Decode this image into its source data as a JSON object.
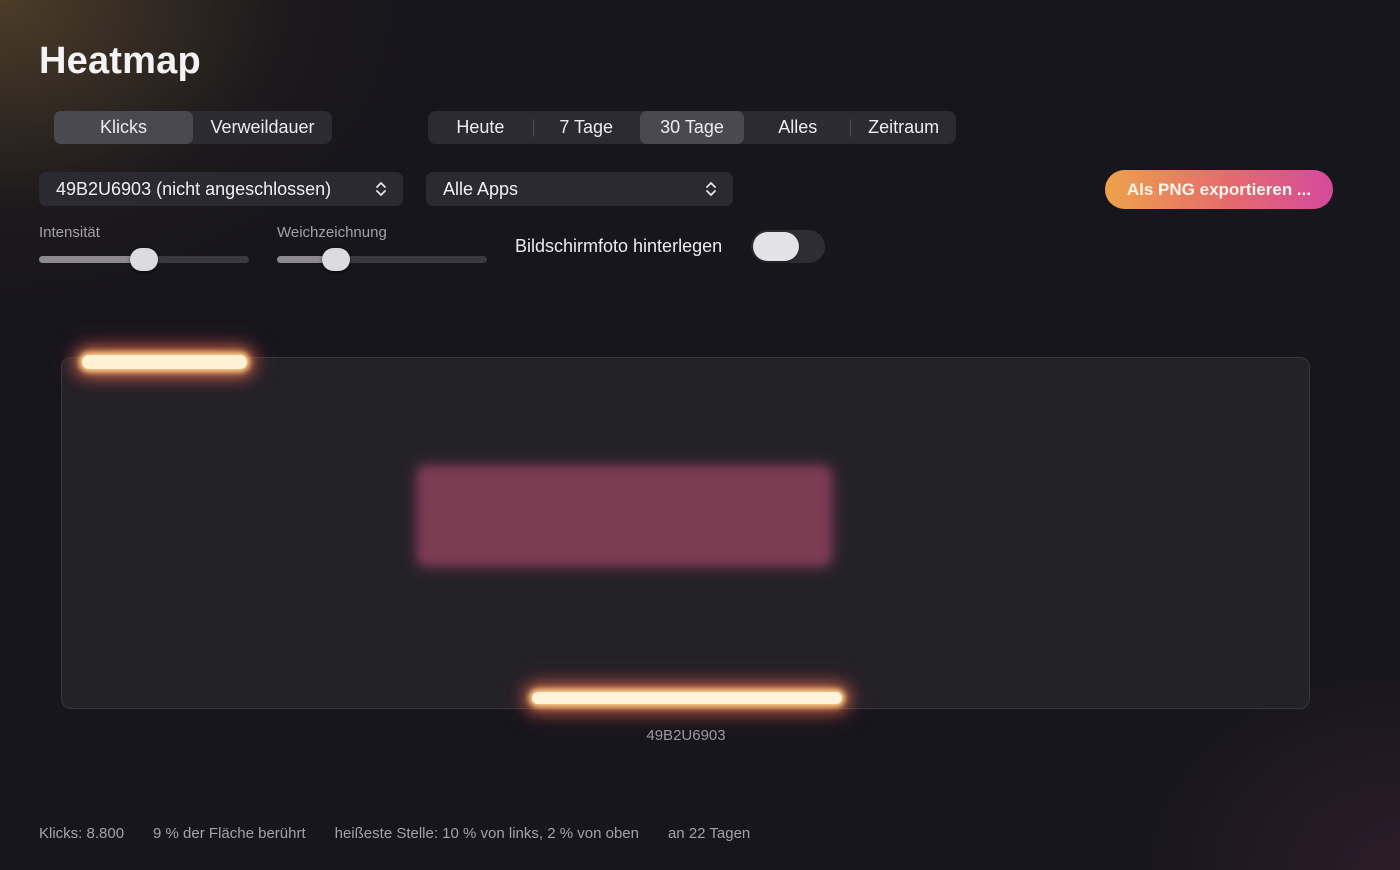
{
  "page": {
    "title": "Heatmap"
  },
  "mode": {
    "options": [
      "Klicks",
      "Verweildauer"
    ],
    "selected": "Klicks"
  },
  "range": {
    "options": [
      "Heute",
      "7 Tage",
      "30 Tage",
      "Alles",
      "Zeitraum"
    ],
    "selected": "30 Tage"
  },
  "device_popup": {
    "value": "49B2U6903 (nicht angeschlossen)"
  },
  "app_popup": {
    "value": "Alle Apps"
  },
  "export_button": {
    "label": "Als PNG exportieren ..."
  },
  "sliders": {
    "intensity": {
      "label": "Intensität",
      "value": 0.5
    },
    "blur": {
      "label": "Weichzeichnung",
      "value": 0.28
    }
  },
  "screenshot_toggle": {
    "label": "Bildschirmfoto hinterlegen",
    "on": false
  },
  "heatmap": {
    "display_name": "49B2U6903"
  },
  "stats": {
    "clicks": "Klicks: 8.800",
    "area": "9 % der Fläche berührt",
    "hottest": "heißeste Stelle: 10 % von links, 2 % von oben",
    "days": "an 22 Tagen"
  },
  "colors": {
    "background": "#17161c",
    "accent_gradient_start": "#eda24a",
    "accent_gradient_end": "#d54a9c",
    "hotspot": "#fff1d4"
  }
}
